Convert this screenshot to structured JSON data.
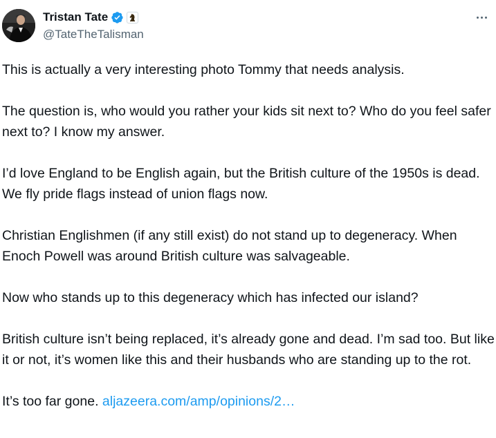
{
  "author": {
    "display_name": "Tristan Tate",
    "handle": "@TateTheTalisman",
    "avatar_icon": "profile-photo",
    "verified_icon": "verified-badge-icon",
    "affiliation_icon": "chess-knight-icon"
  },
  "menu": {
    "icon": "more-options-icon"
  },
  "tweet": {
    "paragraphs": [
      "This is actually a very interesting photo Tommy that needs analysis.",
      "The question is, who would you rather your kids sit next to? Who do you feel safer next to? I know my answer.",
      "I’d love England to be English again, but the British culture of the 1950s is dead. We fly pride flags instead of union flags now.",
      "Christian Englishmen (if any still exist) do not stand up to degeneracy. When Enoch Powell was around British culture was salvageable.",
      "Now who stands up to this degeneracy which has infected our island?",
      "British culture isn’t being replaced, it’s already gone and dead. I’m sad too. But like it or not, it’s women like this and their husbands who are standing up to the rot."
    ],
    "last_line_text": "It’s too far gone.",
    "link_text": "aljazeera.com/amp/opinions/2…"
  },
  "colors": {
    "text": "#0f1419",
    "secondary": "#536471",
    "link": "#1d9bf0",
    "verified": "#1d9bf0"
  }
}
